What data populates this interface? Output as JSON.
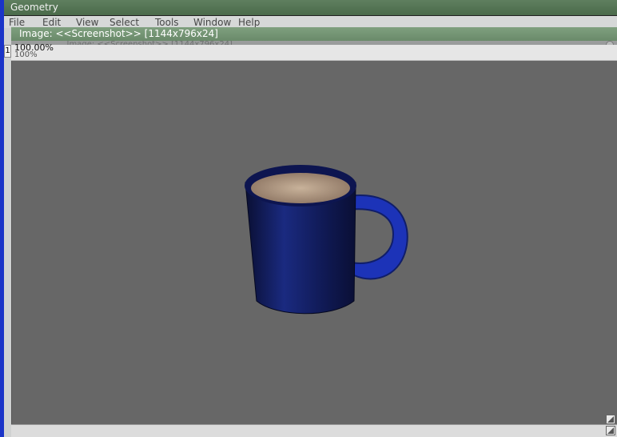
{
  "window": {
    "title": "Geometry"
  },
  "menu": {
    "items": [
      {
        "label": "File"
      },
      {
        "label": "Edit"
      },
      {
        "label": "View"
      },
      {
        "label": "Select"
      },
      {
        "label": "Tools"
      },
      {
        "label": "Window"
      },
      {
        "label": "Help"
      }
    ]
  },
  "image_window": {
    "title": "Image: <<Screenshot>> [1144x796x24]",
    "ghost_title": "...Image: <<Screenshot>> [1144x796x24]",
    "zoom": "100.00%",
    "zoom_ghost": "100%",
    "left_tag": "1"
  },
  "viewport": {
    "background": "#676767",
    "object": "mug-render",
    "mug_color": "#15206a",
    "coffee_color": "#b69c82"
  },
  "icons": [
    "close-icon",
    "resize-corner-icon"
  ]
}
